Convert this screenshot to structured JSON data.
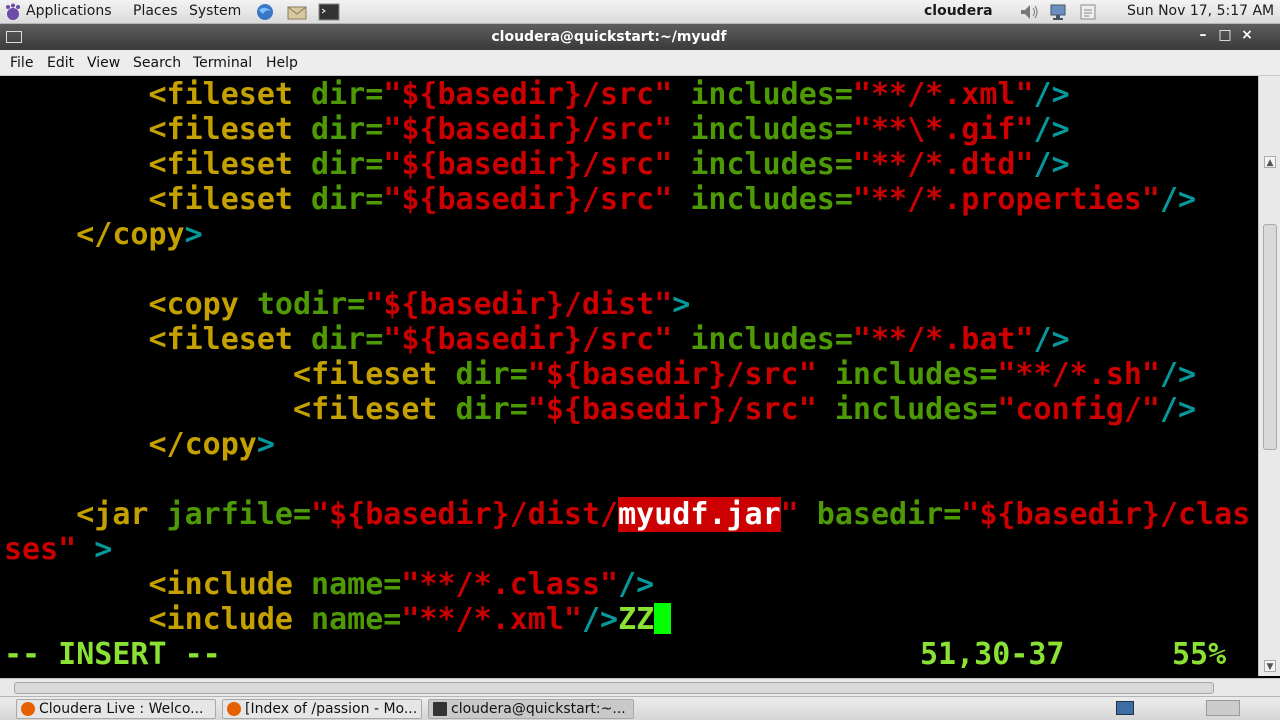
{
  "top_panel": {
    "menus": [
      "Applications",
      "Places",
      "System"
    ],
    "user": "cloudera",
    "clock": "Sun Nov 17,  5:17 AM"
  },
  "window": {
    "title": "cloudera@quickstart:~/myudf",
    "minimize": "–",
    "maximize": "□",
    "close": "×"
  },
  "menubar": [
    "File",
    "Edit",
    "View",
    "Search",
    "Terminal",
    "Help"
  ],
  "editor": {
    "lines": [
      [
        "        ",
        "<fileset",
        " dir=",
        "\"${basedir}/src\"",
        " includes=",
        "\"**/*.xml\"",
        "/>"
      ],
      [
        "        ",
        "<fileset",
        " dir=",
        "\"${basedir}/src\"",
        " includes=",
        "\"**\\*.gif\"",
        "/>"
      ],
      [
        "        ",
        "<fileset",
        " dir=",
        "\"${basedir}/src\"",
        " includes=",
        "\"**/*.dtd\"",
        "/>"
      ],
      [
        "        ",
        "<fileset",
        " dir=",
        "\"${basedir}/src\"",
        " includes=",
        "\"**/*.properties\"",
        "/>"
      ],
      [
        "    ",
        "</copy",
        ">"
      ],
      [
        "        ",
        "<copy",
        " todir=",
        "\"${basedir}/dist\"",
        ">"
      ],
      [
        "        ",
        "<fileset",
        " dir=",
        "\"${basedir}/src\"",
        " includes=",
        "\"**/*.bat\"",
        "/>"
      ],
      [
        "                ",
        "<fileset",
        " dir=",
        "\"${basedir}/src\"",
        " includes=",
        "\"**/*.sh\"",
        "/>"
      ],
      [
        "                ",
        "<fileset",
        " dir=",
        "\"${basedir}/src\"",
        " includes=",
        "\"config/\"",
        "/>"
      ],
      [
        "        ",
        "</copy",
        ">"
      ],
      [
        "    ",
        "<jar",
        " jarfile=",
        "\"${basedir}/dist/",
        "myudf.jar",
        "\"",
        " basedir=",
        "\"${basedir}/clas"
      ],
      [
        "ses\"",
        " >"
      ],
      [
        "        ",
        "<include",
        " name=",
        "\"**/*.class\"",
        "/>"
      ],
      [
        "        ",
        "<include",
        " name=",
        "\"**/*.xml\"",
        "/>",
        "ZZ"
      ]
    ],
    "mode": "-- INSERT --",
    "position": "51,30-37",
    "percent": "55%"
  },
  "taskbar": [
    {
      "label": "Cloudera Live : Welco...",
      "icon": "firefox-icon"
    },
    {
      "label": "[Index of /passion - Mo...",
      "icon": "firefox-icon"
    },
    {
      "label": "cloudera@quickstart:~...",
      "icon": "terminal-icon"
    }
  ]
}
